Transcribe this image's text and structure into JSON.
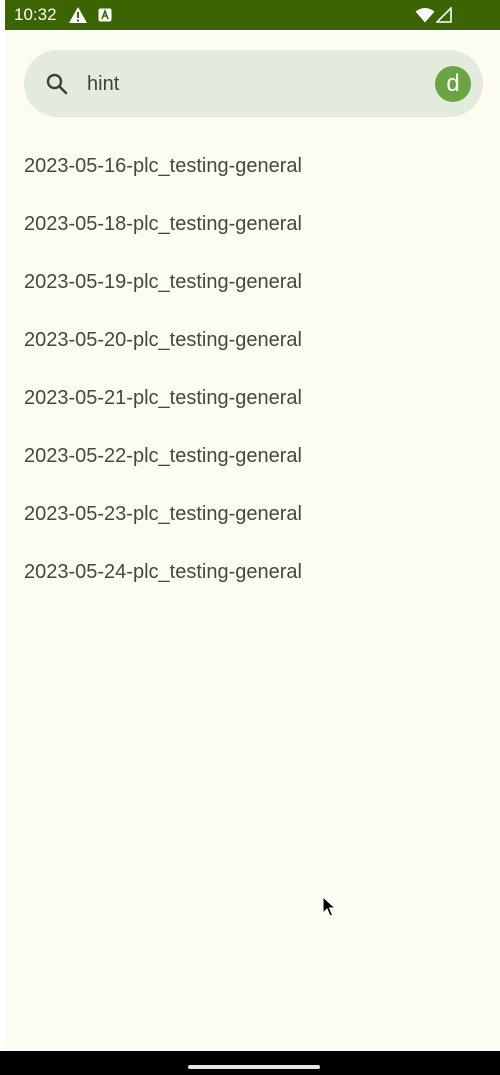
{
  "status_bar": {
    "time": "10:32",
    "left_icons": [
      "warning-icon",
      "text-a-icon"
    ],
    "right_icons": [
      "wifi-icon",
      "signal-icon"
    ],
    "background_color": "#3b6402"
  },
  "search": {
    "value": "hint",
    "icon": "search-icon",
    "avatar_letter": "d",
    "avatar_color": "#6ba443",
    "background_color": "#e3ebdc"
  },
  "results": [
    {
      "label": "2023-05-16-plc_testing-general"
    },
    {
      "label": "2023-05-18-plc_testing-general"
    },
    {
      "label": "2023-05-19-plc_testing-general"
    },
    {
      "label": "2023-05-20-plc_testing-general"
    },
    {
      "label": "2023-05-21-plc_testing-general"
    },
    {
      "label": "2023-05-22-plc_testing-general"
    },
    {
      "label": "2023-05-23-plc_testing-general"
    },
    {
      "label": "2023-05-24-plc_testing-general"
    }
  ]
}
